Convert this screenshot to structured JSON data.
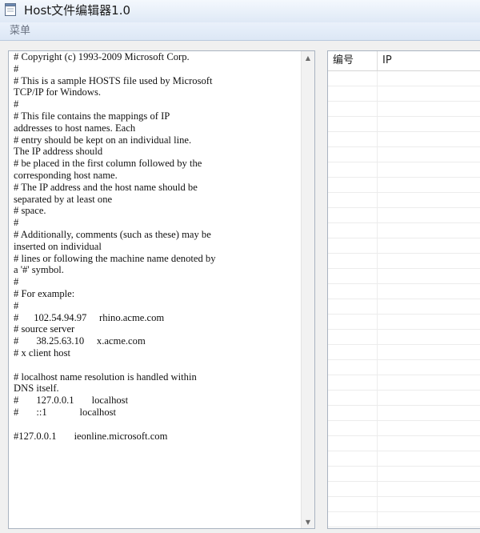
{
  "window": {
    "title": "Host文件编辑器1.0"
  },
  "menu": {
    "items": [
      "菜单"
    ]
  },
  "editor": {
    "content": "# Copyright (c) 1993-2009 Microsoft Corp.\n#\n# This is a sample HOSTS file used by Microsoft\nTCP/IP for Windows.\n#\n# This file contains the mappings of IP\naddresses to host names. Each\n# entry should be kept on an individual line.\nThe IP address should\n# be placed in the first column followed by the\ncorresponding host name.\n# The IP address and the host name should be\nseparated by at least one\n# space.\n#\n# Additionally, comments (such as these) may be\ninserted on individual\n# lines or following the machine name denoted by\na '#' symbol.\n#\n# For example:\n#\n#      102.54.94.97     rhino.acme.com\n# source server\n#       38.25.63.10     x.acme.com\n# x client host\n\n# localhost name resolution is handled within\nDNS itself.\n#       127.0.0.1       localhost\n#       ::1             localhost\n\n#127.0.0.1       ieonline.microsoft.com"
  },
  "table": {
    "columns": [
      "编号",
      "IP"
    ],
    "rows": []
  },
  "colors": {
    "window_frame": "#c8d8ec",
    "content_bg": "#f0f0f0",
    "border": "#a9b3c0"
  }
}
